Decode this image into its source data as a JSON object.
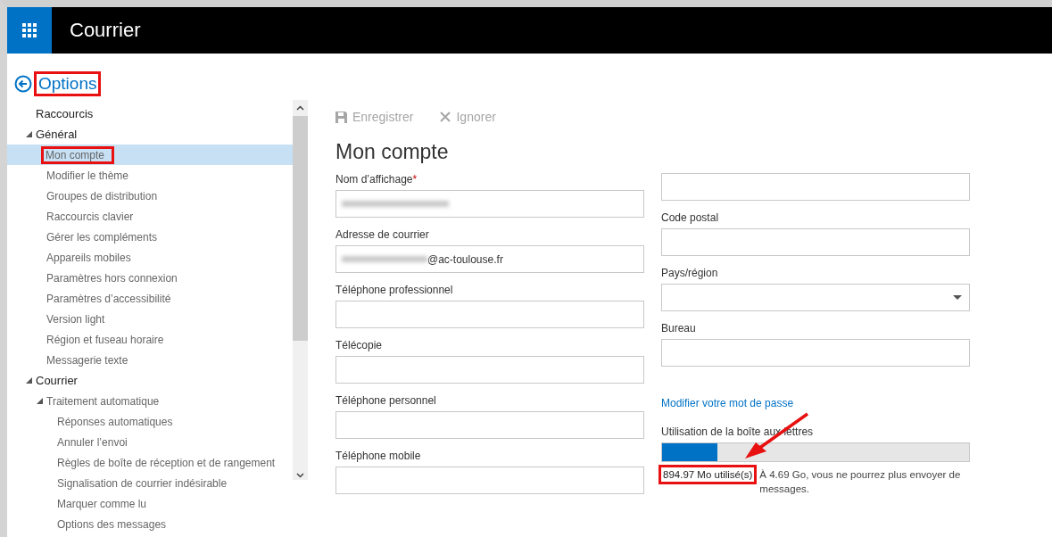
{
  "header": {
    "title": "Courrier"
  },
  "back": {
    "label": "Options",
    "highlighted": true
  },
  "sidebar": {
    "items": [
      {
        "label": "Raccourcis",
        "selected": false,
        "highlighted": false
      },
      {
        "label": "Général",
        "selected": false,
        "highlighted": false,
        "expanded": true,
        "children": [
          {
            "label": "Mon compte",
            "selected": true,
            "highlighted": true
          },
          {
            "label": "Modifier le thème",
            "selected": false,
            "highlighted": false
          },
          {
            "label": "Groupes de distribution",
            "selected": false,
            "highlighted": false
          },
          {
            "label": "Raccourcis clavier",
            "selected": false,
            "highlighted": false
          },
          {
            "label": "Gérer les compléments",
            "selected": false,
            "highlighted": false
          },
          {
            "label": "Appareils mobiles",
            "selected": false,
            "highlighted": false
          },
          {
            "label": "Paramètres hors connexion",
            "selected": false,
            "highlighted": false
          },
          {
            "label": "Paramètres d’accessibilité",
            "selected": false,
            "highlighted": false
          },
          {
            "label": "Version light",
            "selected": false,
            "highlighted": false
          },
          {
            "label": "Région et fuseau horaire",
            "selected": false,
            "highlighted": false
          },
          {
            "label": "Messagerie texte",
            "selected": false,
            "highlighted": false
          }
        ]
      },
      {
        "label": "Courrier",
        "selected": false,
        "highlighted": false,
        "expanded": true,
        "children": [
          {
            "label": "Traitement automatique",
            "selected": false,
            "highlighted": false,
            "expanded": true,
            "children": [
              {
                "label": "Réponses automatiques",
                "selected": false,
                "highlighted": false
              },
              {
                "label": "Annuler l’envoi",
                "selected": false,
                "highlighted": false
              },
              {
                "label": "Règles de boîte de réception et de rangement",
                "selected": false,
                "highlighted": false
              },
              {
                "label": "Signalisation de courrier indésirable",
                "selected": false,
                "highlighted": false
              },
              {
                "label": "Marquer comme lu",
                "selected": false,
                "highlighted": false
              },
              {
                "label": "Options des messages",
                "selected": false,
                "highlighted": false
              }
            ]
          }
        ]
      }
    ]
  },
  "toolbar": [
    {
      "label": "Enregistrer",
      "kind": "save",
      "disabled": true
    },
    {
      "label": "Ignorer",
      "kind": "discard",
      "disabled": true
    }
  ],
  "page_title": "Mon compte",
  "left_fields": [
    {
      "label": "Nom d’affichage",
      "required_mark": "*",
      "redacted": true
    },
    {
      "label": "Adresse de courrier",
      "redacted": true,
      "value": "@ac-toulouse.fr"
    },
    {
      "label": "Téléphone professionnel",
      "redacted": false
    },
    {
      "label": "Télécopie",
      "redacted": false
    },
    {
      "label": "Téléphone personnel",
      "redacted": false
    },
    {
      "label": "Téléphone mobile",
      "redacted": false
    }
  ],
  "right_fields": [
    {
      "kind": "text"
    },
    {
      "label": "Code postal",
      "kind": "text"
    },
    {
      "label": "Pays/région",
      "kind": "select"
    },
    {
      "label": "Bureau",
      "kind": "text"
    }
  ],
  "password_link": "Modifier votre mot de passe",
  "mailbox_usage": {
    "label": "Utilisation de la boîte aux lettres",
    "level": 0.18,
    "reading": "894.97 Mo utilisé(s)",
    "reading_highlighted": true,
    "warning": "À 4.69 Go, vous ne pourrez plus envoyer de messages."
  }
}
